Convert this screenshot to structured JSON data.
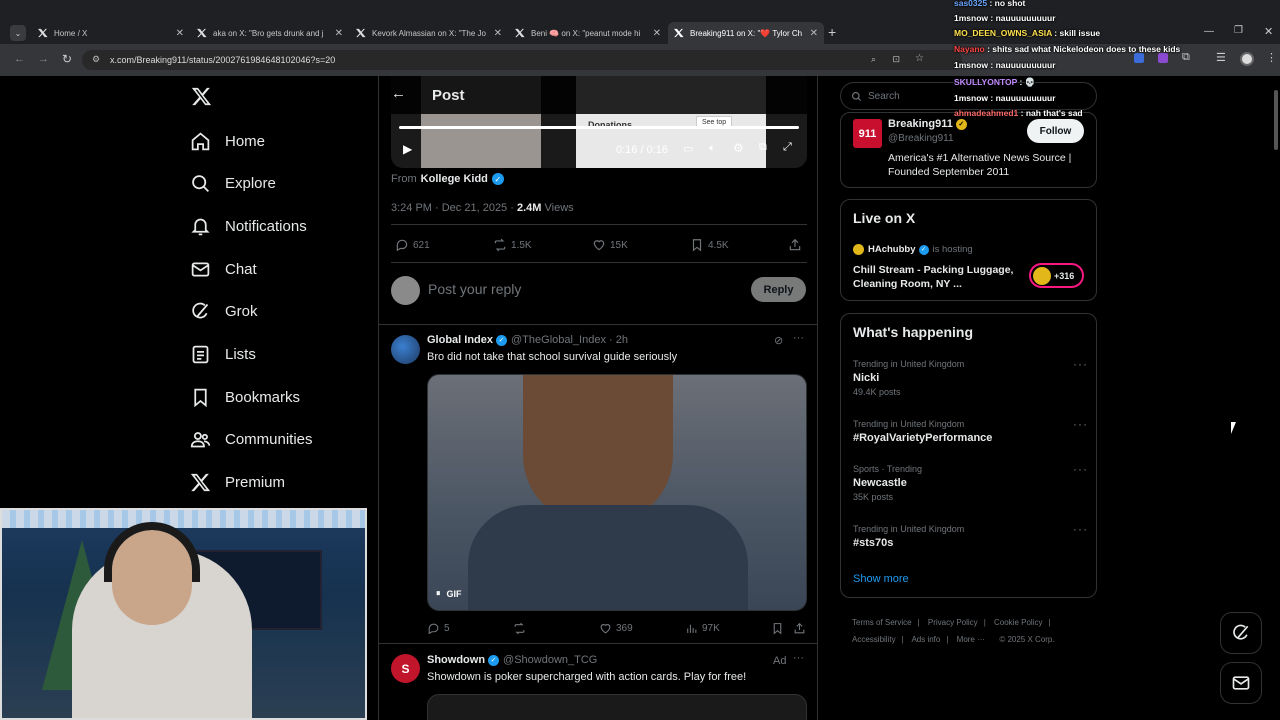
{
  "browser": {
    "tabs": [
      {
        "label": "Home / X",
        "active": false
      },
      {
        "label": "aka on X: \"Bro gets drunk and j",
        "active": false
      },
      {
        "label": "Kevork Almassian on X: \"The Jo",
        "active": false
      },
      {
        "label": "Beni 🧠 on X: \"peanut mode hi",
        "active": false
      },
      {
        "label": "Breaking911 on X: \"❤️ Tylor Ch",
        "active": true
      }
    ],
    "url": "x.com/Breaking911/status/2002761984648102046?s=20"
  },
  "nav": {
    "items": [
      {
        "label": "Home",
        "icon": "home-icon"
      },
      {
        "label": "Explore",
        "icon": "search-icon"
      },
      {
        "label": "Notifications",
        "icon": "bell-icon"
      },
      {
        "label": "Chat",
        "icon": "mail-icon"
      },
      {
        "label": "Grok",
        "icon": "grok-icon"
      },
      {
        "label": "Lists",
        "icon": "list-icon"
      },
      {
        "label": "Bookmarks",
        "icon": "bookmark-icon"
      },
      {
        "label": "Communities",
        "icon": "people-icon"
      },
      {
        "label": "Premium",
        "icon": "x-logo-icon"
      }
    ]
  },
  "post": {
    "header_title": "Post",
    "video_time": "0:16 / 0:16",
    "video_overlay_text": "Donations",
    "video_overlay_btn": "See top",
    "from_label": "From",
    "from_name": "Kollege Kidd",
    "timestamp": "3:24 PM · Dec 21, 2025 ·",
    "views_value": "2.4M",
    "views_label": "Views",
    "replies": "621",
    "reposts": "1.5K",
    "likes": "15K",
    "bookmarks": "4.5K",
    "reply_placeholder": "Post your reply",
    "reply_button": "Reply"
  },
  "reply1": {
    "name": "Global Index",
    "handle": "@TheGlobal_Index · 2h",
    "text": "Bro did not take that school survival guide seriously",
    "gif_label": "GIF",
    "replies": "5",
    "reposts": "",
    "likes": "369",
    "views": "97K"
  },
  "ad": {
    "name": "Showdown",
    "handle": "@Showdown_TCG",
    "ad_label": "Ad",
    "text": "Showdown is poker supercharged with action cards. Play for free!"
  },
  "sidebar": {
    "search_placeholder": "Search",
    "profile": {
      "name": "Breaking911",
      "handle": "@Breaking911",
      "follow": "Follow",
      "bio": "America's #1 Alternative News Source | Founded September 2011"
    },
    "live": {
      "title": "Live on X",
      "host": "HAchubby",
      "hosting": "is hosting",
      "stream_title": "Chill Stream - Packing Luggage, Cleaning Room, NY ...",
      "count": "+316"
    },
    "happening": {
      "title": "What's happening",
      "trends": [
        {
          "context": "Trending in United Kingdom",
          "title": "Nicki",
          "count": "49.4K posts"
        },
        {
          "context": "Trending in United Kingdom",
          "title": "#RoyalVarietyPerformance",
          "count": ""
        },
        {
          "context": "Sports · Trending",
          "title": "Newcastle",
          "count": "35K posts"
        },
        {
          "context": "Trending in United Kingdom",
          "title": "#sts70s",
          "count": ""
        }
      ],
      "show_more": "Show more"
    },
    "footer": [
      "Terms of Service",
      "Privacy Policy",
      "Cookie Policy",
      "Accessibility",
      "Ads info",
      "More ···",
      "© 2025 X Corp."
    ]
  },
  "chat": [
    {
      "user": "sas0325",
      "msg": "no shot",
      "color": "#6aa6ff"
    },
    {
      "user": "1msnow",
      "msg": "nauuuuuuuuur",
      "color": "#ffffff"
    },
    {
      "user": "MO_DEEN_OWNS_ASIA",
      "msg": "skill issue",
      "color": "#ffe14d"
    },
    {
      "user": "Nayano",
      "msg": "shits sad what Nickelodeon does to these kids",
      "color": "#ff4444"
    },
    {
      "user": "1msnow",
      "msg": "nauuuuuuuuur",
      "color": "#ffffff"
    },
    {
      "user": "SKULLYONTOP",
      "msg": "💀",
      "color": "#c38bff"
    },
    {
      "user": "1msnow",
      "msg": "nauuuuuuuuur",
      "color": "#ffffff"
    },
    {
      "user": "ahmadeahmed1",
      "msg": "nah that's sad",
      "color": "#ff6b6b"
    }
  ],
  "colors": {
    "accent": "#1d9bf0",
    "bg": "#000000",
    "border": "#2f3336",
    "muted": "#71767b"
  }
}
